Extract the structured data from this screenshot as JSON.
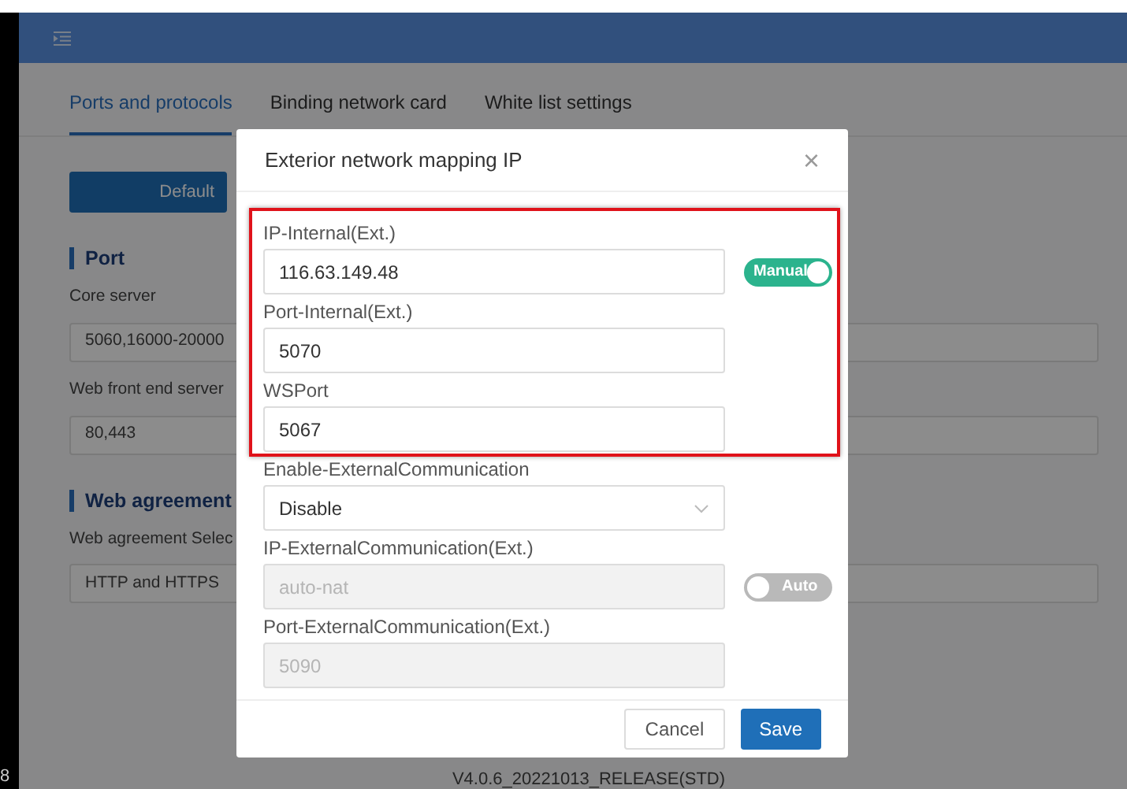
{
  "side_number": "8",
  "tabs": [
    {
      "label": "Ports and protocols",
      "selected": true
    },
    {
      "label": "Binding network card",
      "selected": false
    },
    {
      "label": "White list settings",
      "selected": false
    }
  ],
  "default_button": "Default",
  "sections": [
    {
      "title": "Port",
      "fields": [
        {
          "label": "Core server",
          "value": "5060,16000-20000"
        },
        {
          "label": "Web front end server",
          "value": "80,443"
        }
      ]
    },
    {
      "title": "Web agreement",
      "fields": [
        {
          "label": "Web agreement Selec",
          "value": "HTTP and HTTPS"
        }
      ]
    }
  ],
  "version": "V4.0.6_20221013_RELEASE(STD)",
  "dialog": {
    "title": "Exterior network mapping IP",
    "close": "×",
    "fields": [
      {
        "kind": "input",
        "label": "IP-Internal(Ext.)",
        "value": "116.63.149.48",
        "disabled": false,
        "toggle": {
          "label": "Manual",
          "on": true
        }
      },
      {
        "kind": "input",
        "label": "Port-Internal(Ext.)",
        "value": "5070",
        "disabled": false
      },
      {
        "kind": "input",
        "label": "WSPort",
        "value": "5067",
        "disabled": false
      },
      {
        "kind": "select",
        "label": "Enable-ExternalCommunication",
        "value": "Disable",
        "disabled": false
      },
      {
        "kind": "input",
        "label": "IP-ExternalCommunication(Ext.)",
        "value": "auto-nat",
        "disabled": true,
        "toggle": {
          "label": "Auto",
          "on": false
        }
      },
      {
        "kind": "input",
        "label": "Port-ExternalCommunication(Ext.)",
        "value": "5090",
        "disabled": true
      }
    ],
    "buttons": [
      {
        "label": "Cancel",
        "kind": "secondary"
      },
      {
        "label": "Save",
        "kind": "primary"
      }
    ]
  }
}
